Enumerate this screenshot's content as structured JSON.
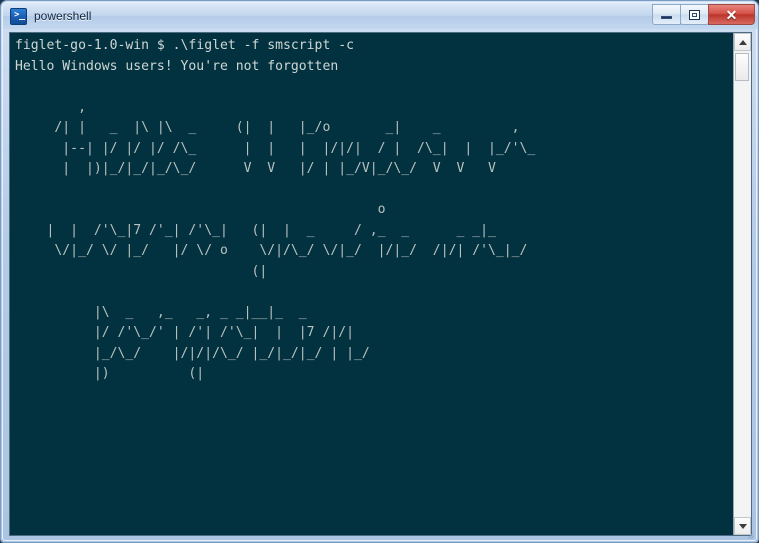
{
  "window": {
    "title": "powershell",
    "icon": "powershell-icon",
    "colors": {
      "titlebar": "#c2d6ed",
      "frame_border": "#7b9bc4",
      "console_background": "#023240",
      "console_text": "#cfd6d3",
      "close_button": "#bc342b"
    },
    "buttons": {
      "minimize": "minimize-button",
      "maximize": "maximize-button",
      "close": "close-button",
      "close_glyph": "✕"
    }
  },
  "console": {
    "prompt_line": "figlet-go-1.0-win $ .\\figlet -f smscript -c",
    "input_line": "Hello Windows users! You're not forgotten",
    "command": {
      "cwd": "figlet-go-1.0-win",
      "prompt_symbol": "$",
      "executable": ".\\figlet",
      "flag_font": "-f",
      "font_name": "smscript",
      "flag_center": "-c"
    },
    "figlet_output": {
      "font": "smscript",
      "blocks": [
        {
          "name": "art-block-1",
          "text": "Hello Windows",
          "lines": [
            "        ,                                                        ",
            "     /| |   _  |\\ |\\  _     (|  |   |_/o       _|    _         , ",
            "      |--| |/ |/ |/ /\\_      |  |   |  |/|/|  / |  /\\_|  |  |_/'\\_",
            "      |  |)|_/|_/|_/\\_/      V  V   |/ | |_/V|_/\\_/  V  V   V   "
          ]
        },
        {
          "name": "art-block-2",
          "text": "users! You're not",
          "lines": [
            "                                              o                  ",
            "    |  |  /'\\_|7 /'_| /'\\_|   (|  |  _     / ,_  _      _ _|_   ",
            "     \\/|_/ \\/ |_/   |/ \\/ o    \\/|/\\_/ \\/|_/  |/|_/  /|/| /'\\_|_/",
            "                              (|                                 "
          ]
        },
        {
          "name": "art-block-3",
          "text": "forgotten",
          "lines": [
            "          |\\  _   ,_   _, _ _|__|_  _           ",
            "          |/ /'\\_/' | /'| /'\\_|  |  |7 /|/|     ",
            "          |_/\\_/    |/|/|/\\_/ |_/|_/|_/ | |_/   ",
            "          |)          (|                        "
          ]
        }
      ]
    }
  },
  "scrollbar": {
    "up_arrow": "scroll-up-arrow",
    "down_arrow": "scroll-down-arrow",
    "thumb": "scrollbar-thumb"
  }
}
